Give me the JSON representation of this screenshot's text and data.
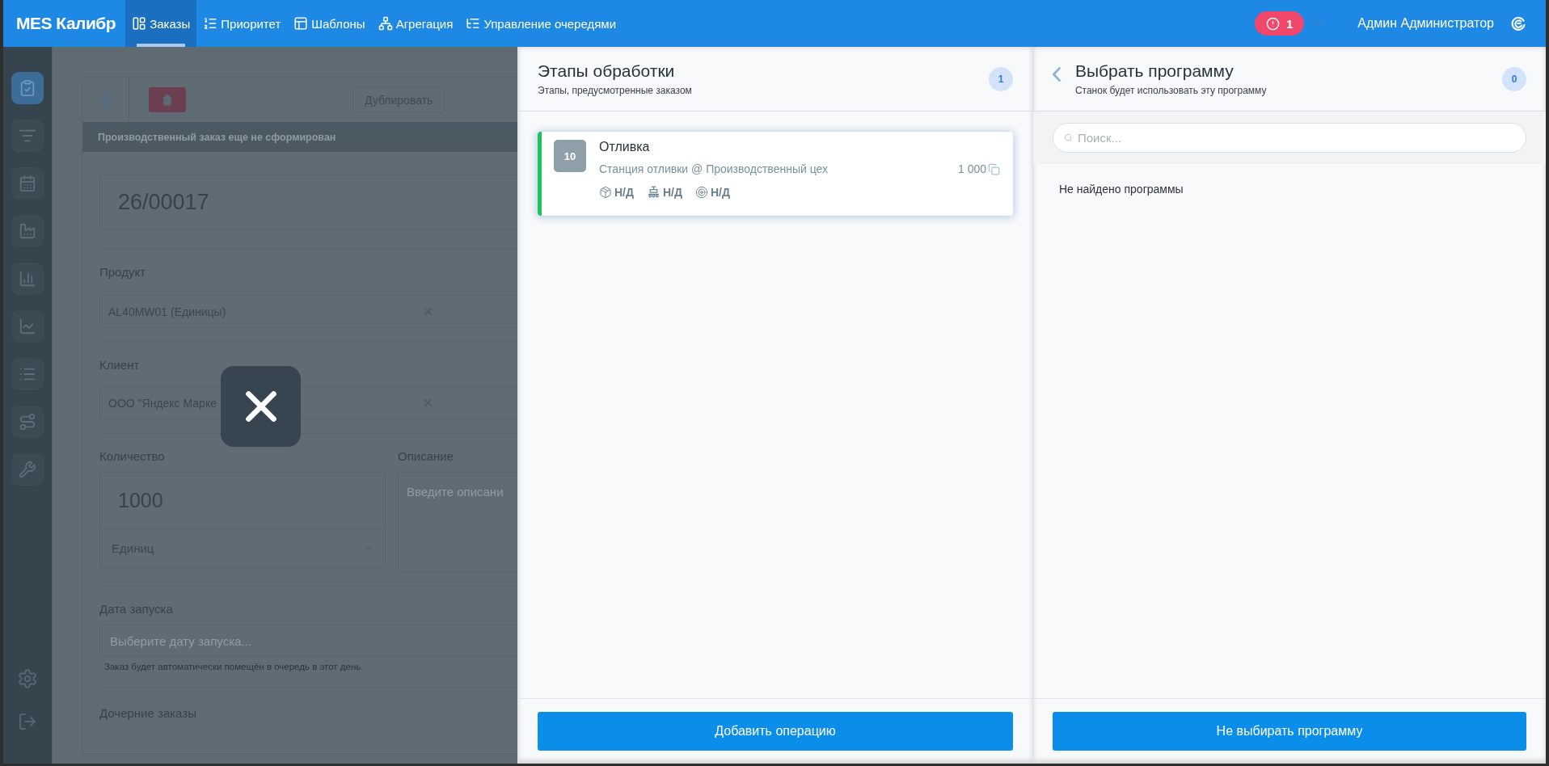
{
  "top_bar": {
    "logo": "MES Калибр",
    "nav": [
      {
        "label": "Заказы",
        "selected": true
      },
      {
        "label": "Приоритет",
        "selected": false
      },
      {
        "label": "Шаблоны",
        "selected": false
      },
      {
        "label": "Агрегация",
        "selected": false
      },
      {
        "label": "Управление очередями",
        "selected": false
      }
    ],
    "alert_count": "1",
    "user": "Админ Администратор"
  },
  "sidebar": {
    "items": [
      {
        "selected": true
      },
      {
        "selected": false
      },
      {
        "selected": false
      },
      {
        "selected": false
      },
      {
        "selected": false
      },
      {
        "selected": false
      },
      {
        "selected": false
      },
      {
        "selected": false
      },
      {
        "selected": false
      }
    ]
  },
  "order_form": {
    "duplicate_button": "Дублировать",
    "status_note": "Производственный заказ еще не сформирован",
    "order_number": "26/00017",
    "product_label": "Продукт",
    "product_value": "AL40MW01 (Единицы)",
    "client_label": "Клиент",
    "client_value": "ООО \"Яндекс Марке",
    "quantity_label": "Количество",
    "quantity_value": "1000",
    "unit_value": "Единиц",
    "description_label": "Описание",
    "description_placeholder": "Введите описани",
    "launch_label": "Дата запуска",
    "launch_placeholder": "Выберите дату запуска...",
    "launch_help": "Заказ будет автоматически помещён в очередь в этот день.",
    "children_label": "Дочерние заказы"
  },
  "stages_panel": {
    "title": "Этапы обработки",
    "subtitle": "Этапы, предусмотренные заказом",
    "count": "1",
    "stages": [
      {
        "number": "10",
        "name": "Отливка",
        "location": "Станция отливки @ Производственный цех",
        "quantity": "1 000",
        "color": "#1fc35b",
        "metrics": [
          "Н/Д",
          "Н/Д",
          "Н/Д"
        ]
      }
    ],
    "add_button": "Добавить операцию"
  },
  "program_panel": {
    "title": "Выбрать программу",
    "subtitle": "Станок будет использовать эту программу",
    "count": "0",
    "search": {
      "placeholder": "Поиск..."
    },
    "empty_text": "Не найдено программы",
    "skip_button": "Не выбирать программу"
  }
}
